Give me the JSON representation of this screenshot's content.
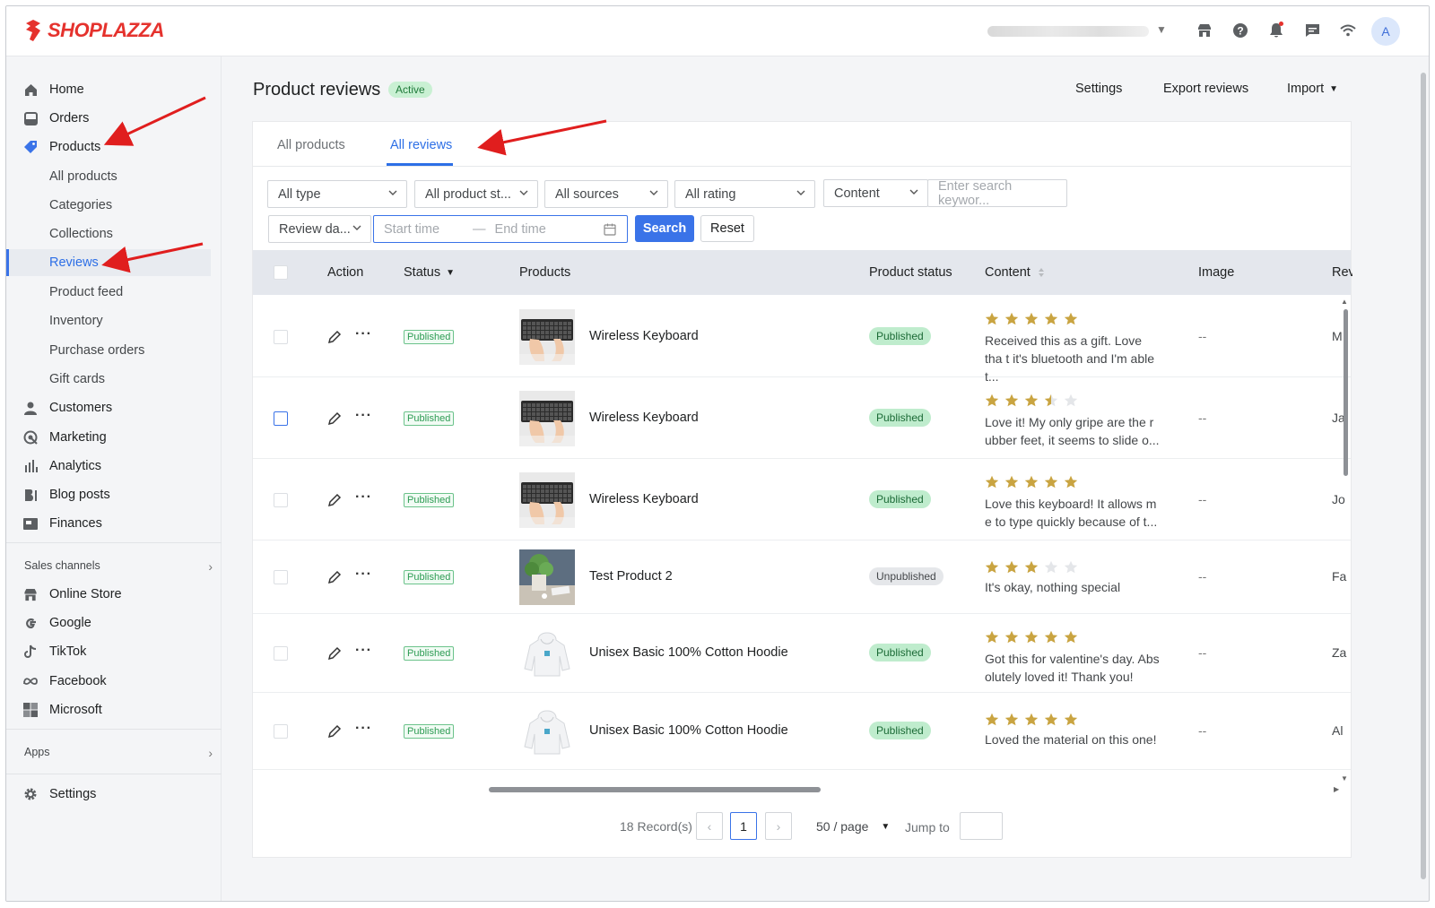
{
  "brand": {
    "name": "SHOPLAZZA",
    "accent": "#e5322d",
    "primary": "#3a73e8"
  },
  "topbar": {
    "icons": [
      "store-icon",
      "help-icon",
      "bell-icon",
      "chat-icon",
      "wifi-icon"
    ],
    "avatar_letter": "A"
  },
  "sidebar": {
    "items": [
      {
        "label": "Home",
        "icon": "home-icon"
      },
      {
        "label": "Orders",
        "icon": "orders-icon"
      },
      {
        "label": "Products",
        "icon": "tag-icon"
      }
    ],
    "product_sub": [
      "All products",
      "Categories",
      "Collections",
      "Reviews",
      "Product feed",
      "Inventory",
      "Purchase orders",
      "Gift cards"
    ],
    "items2": [
      {
        "label": "Customers",
        "icon": "person-icon"
      },
      {
        "label": "Marketing",
        "icon": "marketing-icon"
      },
      {
        "label": "Analytics",
        "icon": "bar-chart-icon"
      },
      {
        "label": "Blog posts",
        "icon": "blog-icon"
      },
      {
        "label": "Finances",
        "icon": "finance-icon"
      }
    ],
    "sales_channels_label": "Sales channels",
    "channels": [
      {
        "label": "Online Store",
        "icon": "store-icon"
      },
      {
        "label": "Google",
        "icon": "google-icon"
      },
      {
        "label": "TikTok",
        "icon": "tiktok-icon"
      },
      {
        "label": "Facebook",
        "icon": "meta-icon"
      },
      {
        "label": "Microsoft",
        "icon": "microsoft-icon"
      }
    ],
    "apps_label": "Apps",
    "settings_label": "Settings"
  },
  "page": {
    "title": "Product reviews",
    "badge": "Active",
    "actions": {
      "settings": "Settings",
      "export": "Export reviews",
      "import": "Import"
    }
  },
  "tabs": [
    "All products",
    "All reviews"
  ],
  "filters": {
    "type": "All type",
    "product_status": "All product st...",
    "sources": "All sources",
    "rating": "All rating",
    "content_select": "Content",
    "search_placeholder": "Enter search keywor...",
    "date_select": "Review da...",
    "start_placeholder": "Start time",
    "end_placeholder": "End time",
    "range_sep": "—",
    "search_btn": "Search",
    "reset_btn": "Reset"
  },
  "table": {
    "headers": {
      "action": "Action",
      "status": "Status",
      "products": "Products",
      "product_status": "Product status",
      "content": "Content",
      "image": "Image",
      "review": "Rev"
    },
    "rows": [
      {
        "status": "Published",
        "product": "Wireless Keyboard",
        "thumb": "keyboard",
        "product_status": "Published",
        "rating": 5,
        "content": "Received this as a gift. Love tha t it's bluetooth and I'm able t...",
        "image": "--",
        "reviewer": "M"
      },
      {
        "status": "Published",
        "product": "Wireless Keyboard",
        "thumb": "keyboard",
        "product_status": "Published",
        "rating": 3.5,
        "content": "Love it! My only gripe are the r ubber feet, it seems to slide o...",
        "image": "--",
        "reviewer": "Ja"
      },
      {
        "status": "Published",
        "product": "Wireless Keyboard",
        "thumb": "keyboard",
        "product_status": "Published",
        "rating": 5,
        "content": "Love this keyboard! It allows m e to type quickly because of t...",
        "image": "--",
        "reviewer": "Jo"
      },
      {
        "status": "Published",
        "product": "Test Product 2",
        "thumb": "plant",
        "product_status": "Unpublished",
        "rating": 3,
        "content": "It's okay, nothing special",
        "image": "--",
        "reviewer": "Fa"
      },
      {
        "status": "Published",
        "product": "Unisex Basic 100% Cotton Hoodie",
        "thumb": "hoodie",
        "product_status": "Published",
        "rating": 5,
        "content": "Got this for valentine's day. Abs olutely loved it! Thank you!",
        "image": "--",
        "reviewer": "Za"
      },
      {
        "status": "Published",
        "product": "Unisex Basic 100% Cotton Hoodie",
        "thumb": "hoodie",
        "product_status": "Published",
        "rating": 5,
        "content": "Loved the material on this one!",
        "image": "--",
        "reviewer": "Al"
      }
    ]
  },
  "pagination": {
    "records": "18 Record(s)",
    "current_page": "1",
    "page_size": "50 / page",
    "jump_label": "Jump to",
    "prev": "‹",
    "next": "›"
  },
  "colors": {
    "star": "#c9a441",
    "star_empty": "#e4e6e9",
    "published_bg": "#bfeccd",
    "active_tab": "#2d6fe6",
    "annotation_arrow": "#e01e1e"
  }
}
